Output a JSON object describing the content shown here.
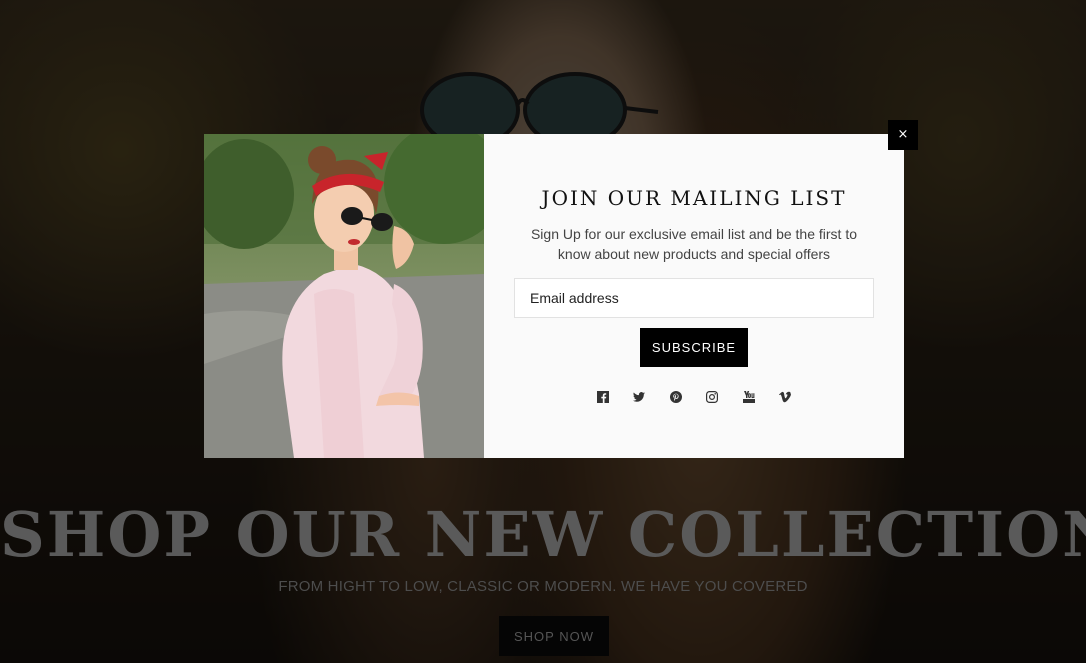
{
  "hero": {
    "title": "SHOP OUR NEW COLLECTION",
    "subtitle": "FROM HIGHT TO LOW, CLASSIC OR MODERN. WE HAVE YOU COVERED",
    "cta_label": "SHOP NOW"
  },
  "popup": {
    "title": "JOIN OUR MAILING LIST",
    "description": "Sign Up for our exclusive email list and be the first to know about new products and special offers",
    "email_placeholder": "Email address",
    "subscribe_label": "SUBSCRIBE",
    "close_label": "×",
    "socials": [
      "facebook-icon",
      "twitter-icon",
      "pinterest-icon",
      "instagram-icon",
      "youtube-icon",
      "vimeo-icon"
    ]
  },
  "colors": {
    "accent": "#000000",
    "modal_bg": "#fafafa",
    "overlay": "rgba(0,0,0,0.62)"
  }
}
